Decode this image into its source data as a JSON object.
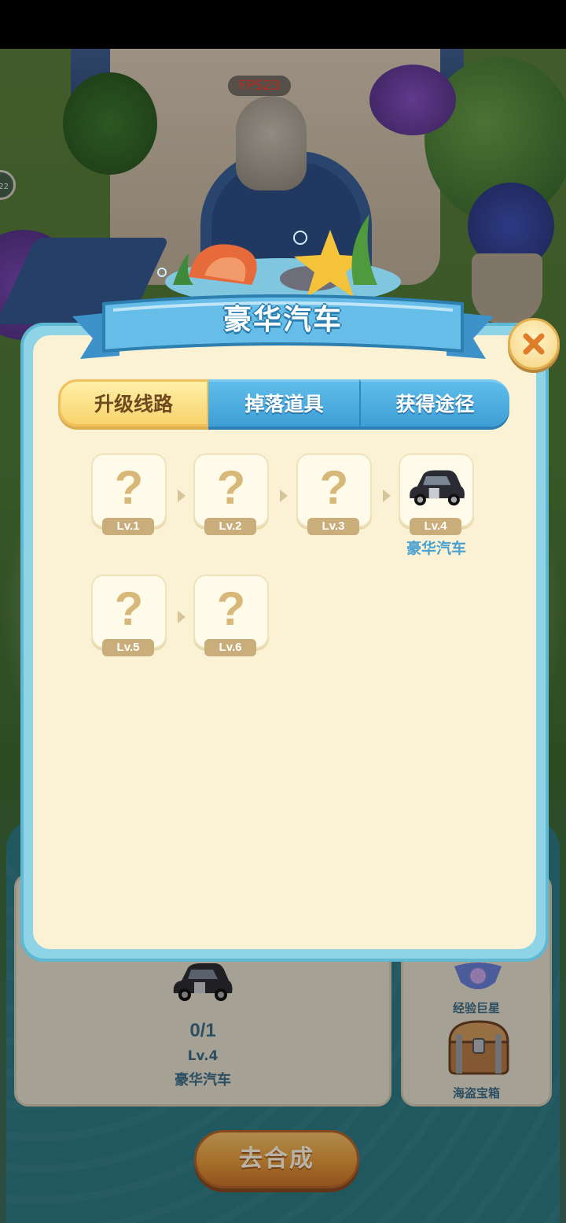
{
  "hud": {
    "fps": "FPS23",
    "ring_text": "22"
  },
  "dialog": {
    "title": "豪华汽车",
    "tabs": [
      {
        "label": "升级线路",
        "active": true
      },
      {
        "label": "掉落道具",
        "active": false
      },
      {
        "label": "获得途径",
        "active": false
      }
    ],
    "levels": [
      {
        "level": "Lv.1",
        "locked": true,
        "name": ""
      },
      {
        "level": "Lv.2",
        "locked": true,
        "name": ""
      },
      {
        "level": "Lv.3",
        "locked": true,
        "name": ""
      },
      {
        "level": "Lv.4",
        "locked": false,
        "name": "豪华汽车"
      },
      {
        "level": "Lv.5",
        "locked": true,
        "name": ""
      },
      {
        "level": "Lv.6",
        "locked": true,
        "name": ""
      }
    ],
    "unknown_symbol": "?"
  },
  "background_panel": {
    "count": "0/1",
    "level": "Lv.4",
    "name": "豪华汽车",
    "source_items": [
      {
        "label": "经验巨星",
        "icon": "star-shell-icon"
      },
      {
        "label": "海盗宝箱",
        "icon": "treasure-chest-icon"
      }
    ],
    "merge_button": "去合成"
  },
  "colors": {
    "accent_blue": "#3e9fd6",
    "tab_active": "#f8d36c",
    "panel_cream": "#fbf2d5",
    "level_badge": "#c9ad7a",
    "name_blue": "#4aa1cf"
  }
}
